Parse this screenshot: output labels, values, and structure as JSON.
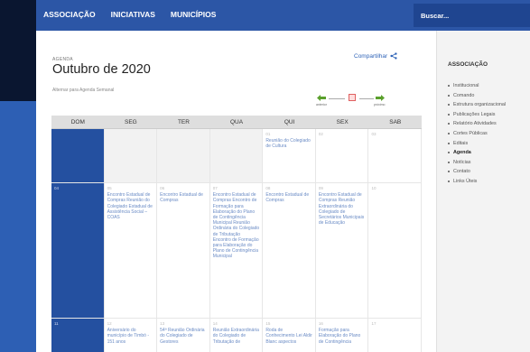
{
  "nav": {
    "items": [
      "ASSOCIAÇÃO",
      "INICIATIVAS",
      "MUNICÍPIOS"
    ],
    "search_placeholder": "Buscar..."
  },
  "header": {
    "agenda_label": "AGENDA",
    "title": "Outubro de 2020",
    "alternate_link": "Alternar para Agenda Semanal",
    "share_label": "Compartilhar",
    "pager_prev": "anterior",
    "pager_next": "próximo"
  },
  "calendar": {
    "weekdays": [
      "DOM",
      "SEG",
      "TER",
      "QUA",
      "QUI",
      "SEX",
      "SAB"
    ],
    "rows": [
      [
        {
          "num": "",
          "events": ""
        },
        {
          "num": "",
          "events": ""
        },
        {
          "num": "",
          "events": ""
        },
        {
          "num": "",
          "events": ""
        },
        {
          "num": "01",
          "events": "Reunião do Colegiado de Cultura"
        },
        {
          "num": "02",
          "events": ""
        },
        {
          "num": "03",
          "events": ""
        }
      ],
      [
        {
          "num": "04",
          "events": ""
        },
        {
          "num": "05",
          "events": "Encontro Estadual de Compras Reunião do Colegiado Estadual de Assistência Social – COAS"
        },
        {
          "num": "06",
          "events": "Encontro Estadual de Compras"
        },
        {
          "num": "07",
          "events": "Encontro Estadual de Compras Encontro de Formação para Elaboração do Plano de Contingência Municipal Reunião Ordinária do Colegiado de Tributação Encontro de Formação para Elaboração do Plano de Contingência Municipal"
        },
        {
          "num": "08",
          "events": "Encontro Estadual de Compras"
        },
        {
          "num": "09",
          "events": "Encontro Estadual de Compras Reunião Extraordinária do Colegiado de Secretários Municipais de Educação"
        },
        {
          "num": "10",
          "events": ""
        }
      ],
      [
        {
          "num": "11",
          "events": ""
        },
        {
          "num": "12",
          "events": "Aniversário do município de Timbó - 151 anos"
        },
        {
          "num": "13",
          "events": "54ª Reunião Ordinária do Colegiado de Gestores"
        },
        {
          "num": "14",
          "events": "Reunião Extraordinária do Colegiado de Tributação de"
        },
        {
          "num": "15",
          "events": "Roda de Conhecimento Lei Aldir Blanc aspectos"
        },
        {
          "num": "16",
          "events": "Formação para Elaboração do Plano de Contingência"
        },
        {
          "num": "17",
          "events": ""
        }
      ]
    ]
  },
  "sidebar": {
    "title": "ASSOCIAÇÃO",
    "items": [
      "Institucional",
      "Comando",
      "Estrutura organizacional",
      "Publicações Legais",
      "Relatório Atividades",
      "Cortes Públicas",
      "Editais",
      "Agenda",
      "Notícias",
      "Contato",
      "Links Úteis"
    ],
    "active_index": 7
  },
  "colors": {
    "topbar": "#2c56a6",
    "accent": "#3064b8",
    "sunday": "#2450a0"
  }
}
